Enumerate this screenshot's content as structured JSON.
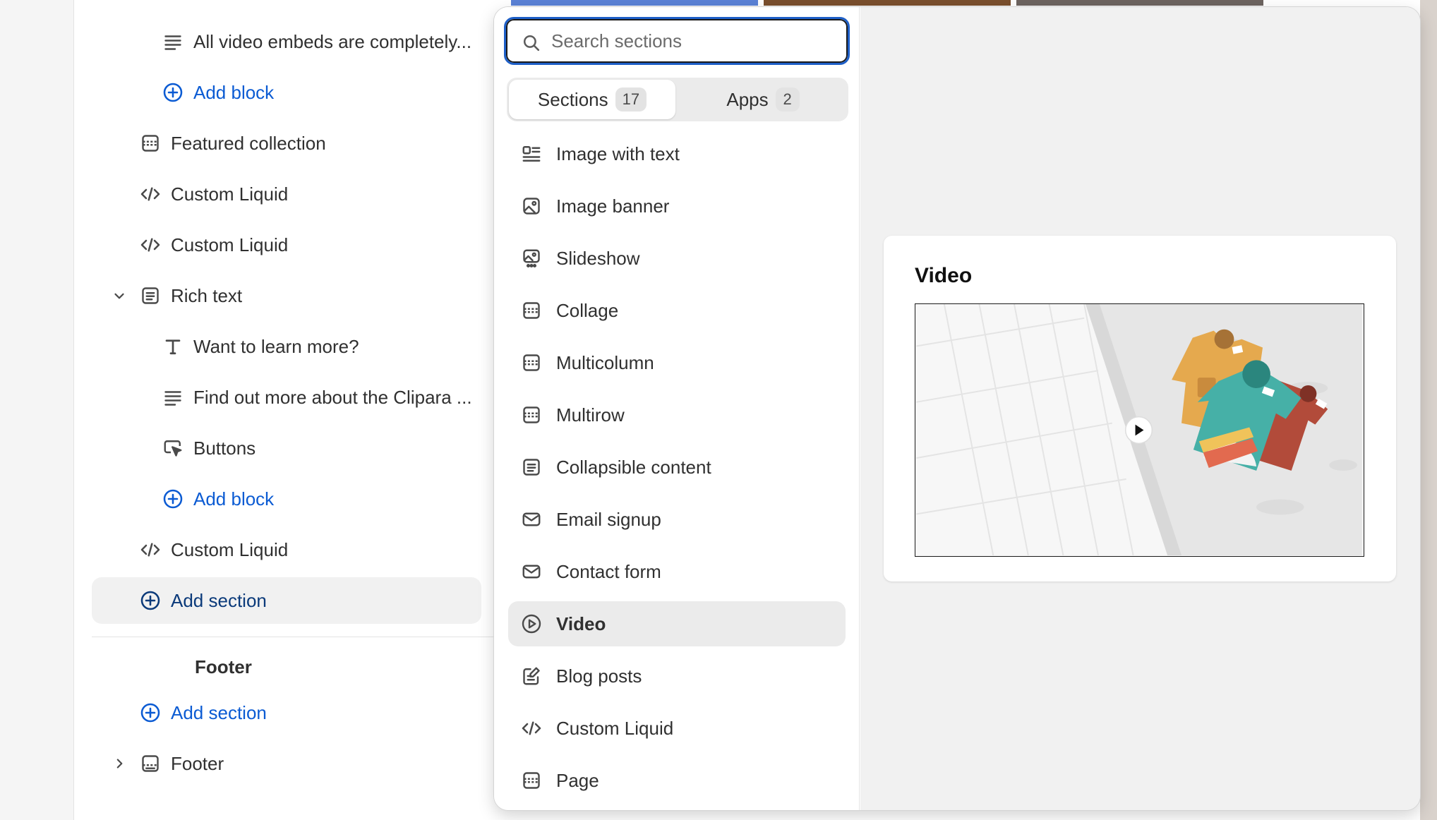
{
  "tree": {
    "rows": [
      {
        "label": "All video embeds are completely...",
        "icon": "text-lines-icon",
        "level": 2,
        "link": false
      },
      {
        "label": "Add block",
        "icon": "plus-circle-icon",
        "level": 2,
        "link": true
      },
      {
        "label": "Featured collection",
        "icon": "section-layout-icon",
        "level": 1,
        "link": false
      },
      {
        "label": "Custom Liquid",
        "icon": "code-icon",
        "level": 1,
        "link": false
      },
      {
        "label": "Custom Liquid",
        "icon": "code-icon",
        "level": 1,
        "link": false
      },
      {
        "label": "Rich text",
        "icon": "rich-text-icon",
        "level": 1,
        "link": false,
        "expanded": true
      },
      {
        "label": "Want to learn more?",
        "icon": "text-heading-icon",
        "level": 2,
        "link": false
      },
      {
        "label": "Find out more about the Clipara ...",
        "icon": "text-lines-icon",
        "level": 2,
        "link": false
      },
      {
        "label": "Buttons",
        "icon": "button-cursor-icon",
        "level": 2,
        "link": false
      },
      {
        "label": "Add block",
        "icon": "plus-circle-icon",
        "level": 2,
        "link": true
      },
      {
        "label": "Custom Liquid",
        "icon": "code-icon",
        "level": 1,
        "link": false
      },
      {
        "label": "Add section",
        "icon": "plus-circle-icon",
        "level": 1,
        "link": true,
        "active": true
      }
    ],
    "footer_group_title": "Footer",
    "footer_add_section": "Add section",
    "footer_section": "Footer"
  },
  "picker": {
    "search_placeholder": "Search sections",
    "search_value": "",
    "tabs": [
      {
        "label": "Sections",
        "count": "17",
        "active": true
      },
      {
        "label": "Apps",
        "count": "2",
        "active": false
      }
    ],
    "items": [
      {
        "label": "Image with text",
        "icon": "image-with-text-icon"
      },
      {
        "label": "Image banner",
        "icon": "image-banner-icon"
      },
      {
        "label": "Slideshow",
        "icon": "slideshow-icon"
      },
      {
        "label": "Collage",
        "icon": "section-layout-icon"
      },
      {
        "label": "Multicolumn",
        "icon": "section-layout-icon"
      },
      {
        "label": "Multirow",
        "icon": "section-layout-icon"
      },
      {
        "label": "Collapsible content",
        "icon": "rich-text-icon"
      },
      {
        "label": "Email signup",
        "icon": "envelope-icon"
      },
      {
        "label": "Contact form",
        "icon": "envelope-icon"
      },
      {
        "label": "Video",
        "icon": "play-circle-icon",
        "selected": true
      },
      {
        "label": "Blog posts",
        "icon": "blog-edit-icon"
      },
      {
        "label": "Custom Liquid",
        "icon": "code-icon"
      },
      {
        "label": "Page",
        "icon": "section-layout-icon"
      }
    ],
    "preview_title": "Video"
  },
  "colors": {
    "accent_blue": "#0b5bd3",
    "focus_ring": "#1e5fc7",
    "selected_bg": "#ebebeb",
    "preview_bg": "#f1f1f1"
  }
}
